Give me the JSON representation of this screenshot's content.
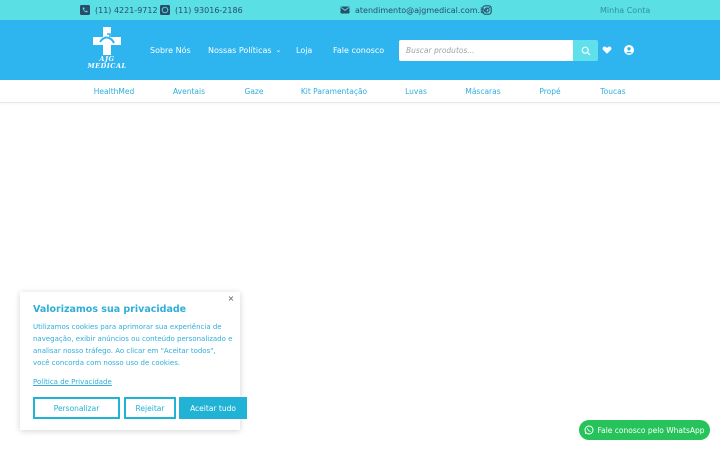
{
  "topbar": {
    "phone": "(11) 4221-9712",
    "whatsapp": "(11) 93016-2186",
    "email": "atendimento@ajgmedical.com.br",
    "account": "Minha Conta"
  },
  "header": {
    "logo_text_1": "AJG",
    "logo_text_2": "MEDICAL",
    "nav": [
      "Sobre Nós",
      "Nossas Políticas",
      "Loja",
      "Fale conosco"
    ],
    "search_placeholder": "Buscar produtos..."
  },
  "categories": [
    "HealthMed",
    "Aventais",
    "Gaze",
    "Kit Paramentação",
    "Luvas",
    "Máscaras",
    "Propé",
    "Toucas"
  ],
  "cookie": {
    "close": "×",
    "title": "Valorizamos sua privacidade",
    "body": "Utilizamos cookies para aprimorar sua experiência de navegação, exibir anúncios ou conteúdo personalizado e analisar nosso tráfego. Ao clicar em \"Aceitar todos\", você concorda com nosso uso de cookies.",
    "policy_link": "Política de Privacidade",
    "btn_customize": "Personalizar",
    "btn_reject": "Rejeitar",
    "btn_accept": "Aceitar tudo"
  },
  "whatsapp_button": "Fale conosco pelo WhatsApp",
  "colors": {
    "topbar": "#59dfe4",
    "header": "#2eb4ee",
    "accent": "#20b3d6",
    "whatsapp": "#25c35a"
  },
  "icons": [
    "phone-icon",
    "whatsapp-icon",
    "mail-icon",
    "instagram-icon",
    "search-icon",
    "heart-icon",
    "user-icon",
    "chevron-down-icon"
  ]
}
